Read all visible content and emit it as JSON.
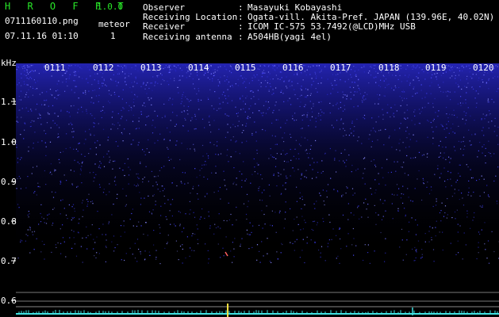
{
  "app": {
    "title": "H R O F F T",
    "version": "1.0.0"
  },
  "file": {
    "name": "0711160110.png",
    "datetime": "07.11.16 01:10"
  },
  "detection": {
    "type": "meteor",
    "count": "1"
  },
  "info": [
    {
      "key": "Observer",
      "value": "Masayuki Kobayashi"
    },
    {
      "key": "Receiving Location",
      "value": "Ogata-vill. Akita-Pref. JAPAN (139.96E, 40.02N)"
    },
    {
      "key": "Receiver",
      "value": "ICOM IC-575 53.7492(@LCD)MHz USB"
    },
    {
      "key": "Receiving antenna",
      "value": "A504HB(yagi 4el)"
    }
  ],
  "separator": ":",
  "axis": {
    "y_unit": "kHz",
    "y_ticks": [
      "1.1",
      "1.0",
      "0.9",
      "0.8",
      "0.7",
      "0.6"
    ],
    "x_ticks": [
      "0111",
      "0112",
      "0113",
      "0114",
      "0115",
      "0116",
      "0117",
      "0118",
      "0119",
      "0120"
    ]
  },
  "colors": {
    "title": "#29e829",
    "noise_high": "#3a3aff",
    "noise_low": "#1a1a80",
    "meteor_echo": "#ffe040",
    "baseline": "#40e0e0"
  }
}
